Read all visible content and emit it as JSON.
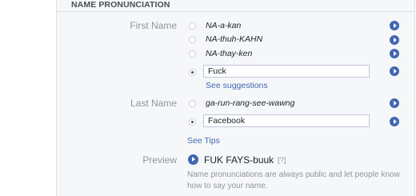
{
  "section": {
    "title": "NAME PRONUNCIATION"
  },
  "first_name": {
    "label": "First Name",
    "options": [
      "NA-a-kan",
      "NA-thuh-KAHN",
      "NA-thay-ken"
    ],
    "custom_value": "Fuck",
    "suggestions_link": "See suggestions"
  },
  "last_name": {
    "label": "Last Name",
    "options": [
      "ga-run-rang-see-wawng"
    ],
    "custom_value": "Facebook"
  },
  "tips_link": "See Tips",
  "preview": {
    "label": "Preview",
    "text": "FUK FAYS-buuk",
    "help": "[?]"
  },
  "note": "Name pronunciations are always public and let people know how to say your name.",
  "colors": {
    "accent": "#4267b2",
    "panel": "#f6f7f9",
    "muted": "#90949c"
  }
}
